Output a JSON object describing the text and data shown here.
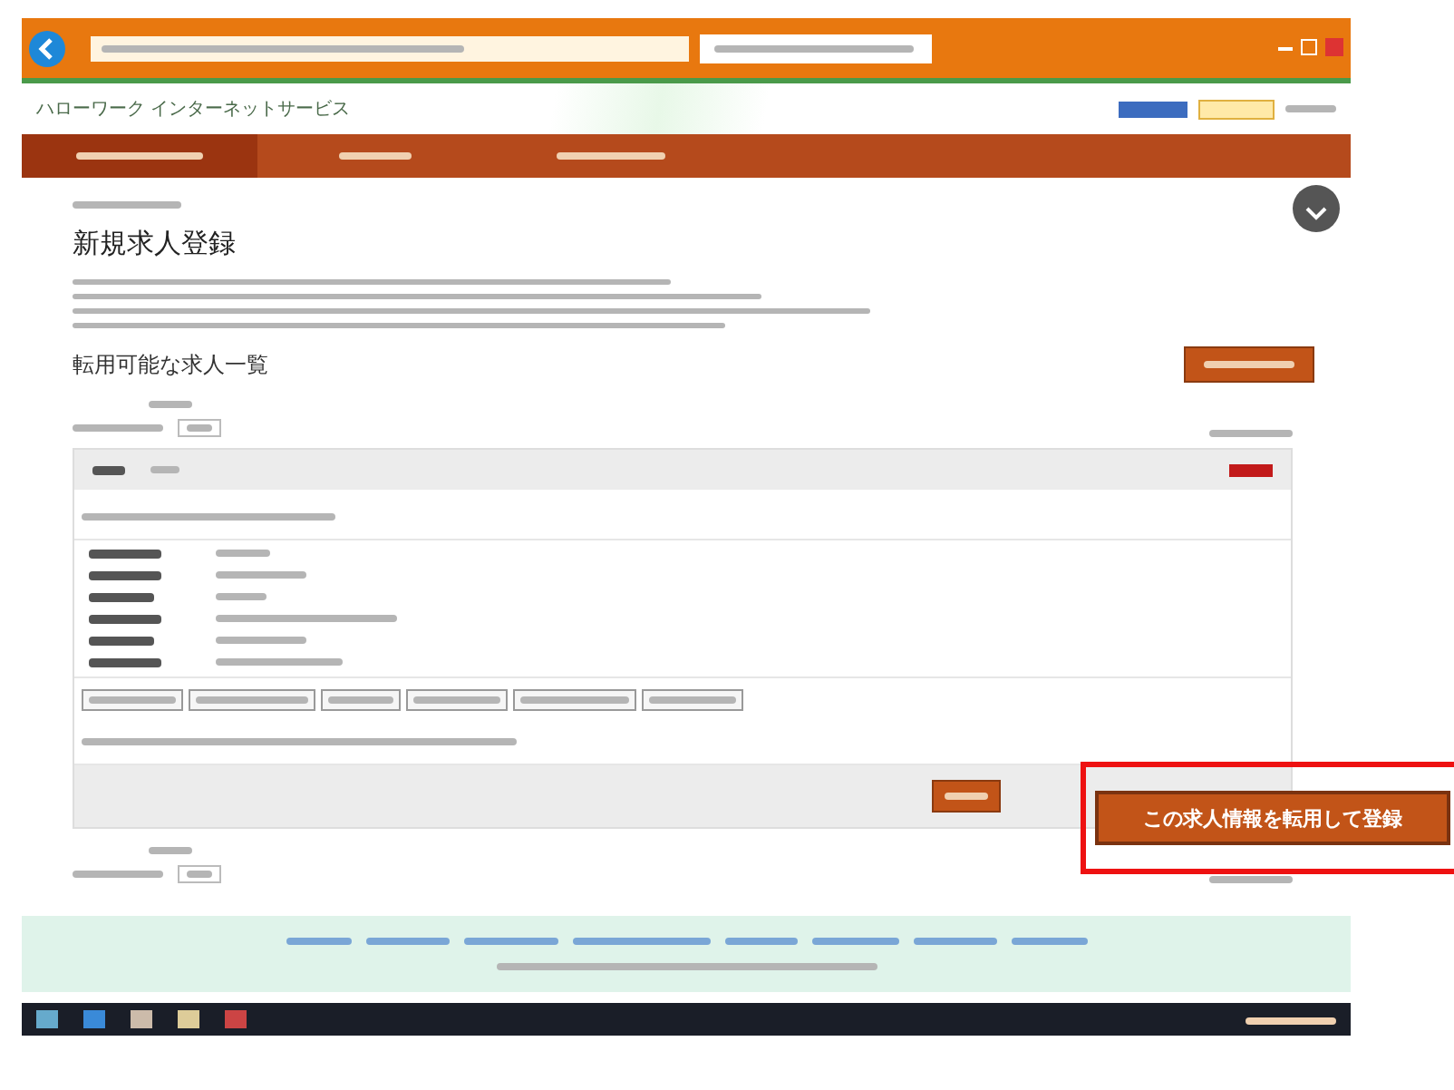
{
  "site": {
    "name": "ハローワーク インターネットサービス"
  },
  "nav": [
    {
      "selected": true
    },
    {
      "selected": false
    },
    {
      "selected": false
    }
  ],
  "page": {
    "title": "新規求人登録",
    "section_heading": "転用可能な求人一覧"
  },
  "callout": {
    "button": "この求人情報を転用して登録"
  }
}
